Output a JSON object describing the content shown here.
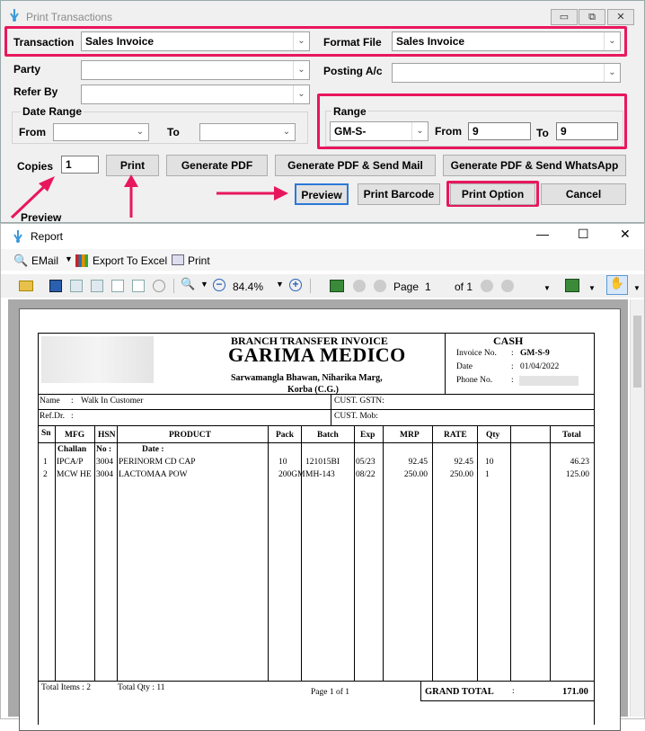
{
  "print_window": {
    "title": "Print Transactions",
    "transaction_label": "Transaction",
    "transaction_value": "Sales Invoice",
    "format_label": "Format File",
    "format_value": "Sales Invoice",
    "party_label": "Party",
    "party_value": "",
    "posting_label": "Posting A/c",
    "posting_value": "",
    "refer_label": "Refer By",
    "refer_value": "",
    "date_range_label": "Date Range",
    "from_label": "From",
    "to_label": "To",
    "range_label": "Range",
    "range_series": "GM-S-",
    "range_from_label": "From",
    "range_from": "9",
    "range_to_label": "To",
    "range_to": "9",
    "copies_label": "Copies",
    "copies_value": "1",
    "buttons": {
      "print": "Print",
      "gen_pdf": "Generate PDF",
      "gen_pdf_mail": "Generate PDF & Send Mail",
      "gen_pdf_whatsapp": "Generate PDF & Send WhatsApp",
      "preview": "Preview",
      "print_barcode": "Print Barcode",
      "print_option": "Print Option",
      "cancel": "Cancel"
    },
    "preview_label": "Preview",
    "win_btns": [
      "▭",
      "⧉",
      "✕"
    ]
  },
  "report_window": {
    "title": "Report",
    "menu": {
      "email": "EMail",
      "export": "Export To Excel",
      "print": "Print"
    },
    "zoom": "84.4%",
    "page_label": "Page",
    "page_value": "1",
    "of_label": "of 1",
    "win_btns": [
      "—",
      "☐",
      "✕"
    ]
  },
  "invoice": {
    "doc_title": "BRANCH TRANSFER INVOICE",
    "company": "GARIMA MEDICO",
    "address1": "Sarwamangla Bhawan, Niharika Marg,",
    "address2": "Korba (C.G.)",
    "cash": "CASH",
    "invoice_no_label": "Invoice No.",
    "invoice_no": "GM-S-9",
    "date_label": "Date",
    "date": "01/04/2022",
    "phone_label": "Phone No.",
    "name_label": "Name",
    "name": "Walk In Customer",
    "gstn_label": "CUST. GSTN:",
    "refdr_label": "Ref.Dr.",
    "mob_label": "CUST. Mob:",
    "headers": {
      "sn": "Sn",
      "mfg": "MFG",
      "hsn": "HSN",
      "product": "PRODUCT",
      "pack": "Pack",
      "batch": "Batch",
      "exp": "Exp",
      "mrp": "MRP",
      "rate": "RATE",
      "qty": "Qty",
      "total": "Total"
    },
    "challan_label": "Challan",
    "no_label": "No :",
    "date_sub_label": "Date :",
    "rows": [
      {
        "sn": "1",
        "mfg": "IPCA/P",
        "hsn": "3004",
        "product": "PERINORM CD CAP",
        "pack": "10",
        "batch": "121015BI",
        "exp": "05/23",
        "mrp": "92.45",
        "rate": "92.45",
        "qty": "10",
        "total": "46.23"
      },
      {
        "sn": "2",
        "mfg": "MCW HE",
        "hsn": "3004",
        "product": "LACTOMAA POW",
        "pack": "200GM",
        "batch": "MH-143",
        "exp": "08/22",
        "mrp": "250.00",
        "rate": "250.00",
        "qty": "1",
        "total": "125.00"
      }
    ],
    "total_items": "Total Items : 2",
    "total_qty": "Total Qty : 11",
    "page_of": "Page 1 of 1",
    "grand_total_label": "GRAND TOTAL",
    "grand_total": "171.00"
  }
}
